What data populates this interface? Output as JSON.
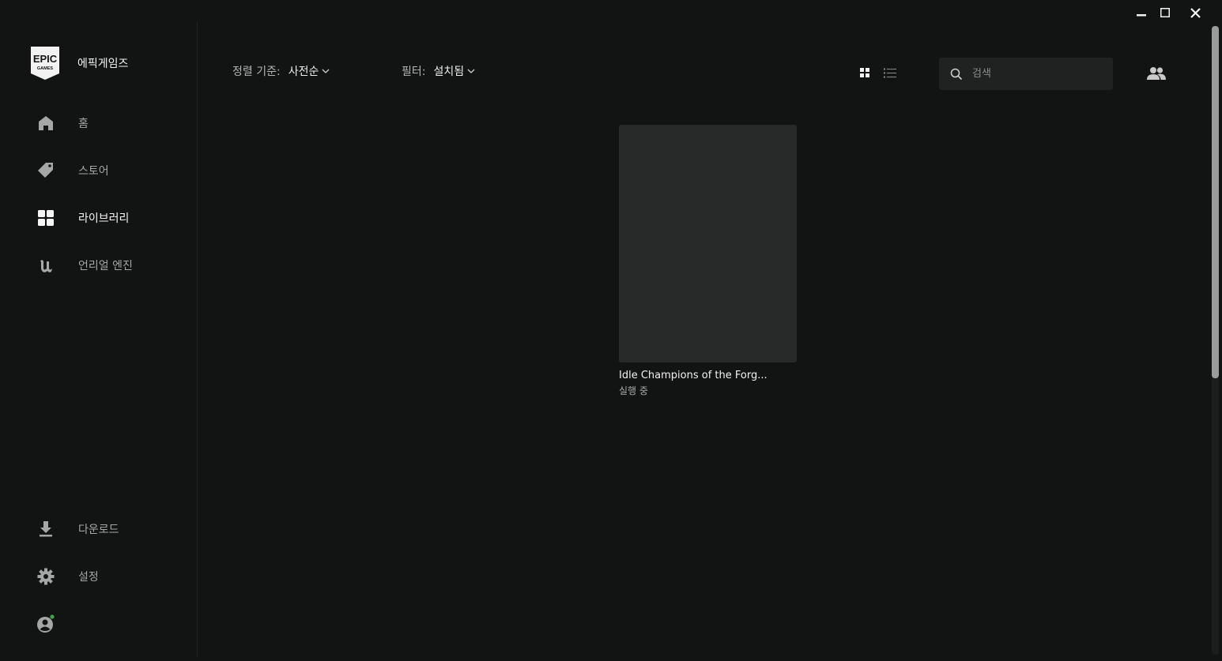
{
  "brand": {
    "logo_text_top": "EPIC",
    "logo_text_bottom": "GAMES",
    "name": "에픽게임즈"
  },
  "window_controls": {
    "minimize": "minimize-icon",
    "maximize": "maximize-icon",
    "close": "close-icon"
  },
  "sidebar": {
    "items": [
      {
        "label": "홈",
        "icon": "home-icon"
      },
      {
        "label": "스토어",
        "icon": "tag-icon"
      },
      {
        "label": "라이브러리",
        "icon": "grid-icon",
        "active": true
      },
      {
        "label": "언리얼 엔진",
        "icon": "unreal-icon"
      }
    ],
    "bottom_items": [
      {
        "label": "다운로드",
        "icon": "download-icon"
      },
      {
        "label": "설정",
        "icon": "gear-icon"
      }
    ],
    "profile": {
      "icon": "account-icon",
      "status_color": "#3fa34d"
    }
  },
  "toolbar": {
    "sort_label": "정렬 기준:",
    "sort_value": "사전순",
    "filter_label": "필터:",
    "filter_value": "설치됨",
    "view_modes": [
      "grid-view-icon",
      "list-view-icon"
    ],
    "search_placeholder": "검색"
  },
  "library": {
    "games": [
      {
        "title": "Idle Champions of the Forg...",
        "status": "실행 중"
      }
    ]
  },
  "colors": {
    "background": "#121413",
    "card": "#282a29",
    "search_bg": "#202221",
    "text_active": "#f5f5f5",
    "text_muted": "#a5a7a6"
  }
}
